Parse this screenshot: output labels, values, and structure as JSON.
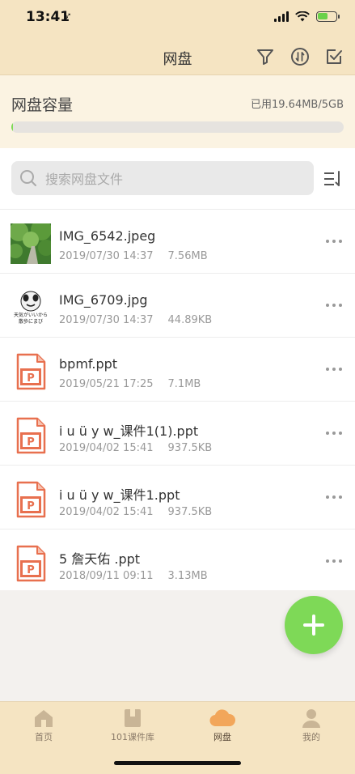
{
  "status_bar": {
    "time": "13:41",
    "location_glyph": "➶"
  },
  "nav": {
    "title": "网盘",
    "icons": [
      "filter-icon",
      "transfer-icon",
      "select-icon"
    ]
  },
  "quota": {
    "label": "网盘容量",
    "used_text": "已用19.64MB/5GB",
    "progress_fraction": 0.004
  },
  "search": {
    "placeholder": "搜索网盘文件",
    "value": ""
  },
  "files": [
    {
      "name": "IMG_6542.jpeg",
      "date": "2019/07/30 14:37",
      "size": "7.56MB",
      "icon": "photo-thumbnail-icon"
    },
    {
      "name": "IMG_6709.jpg",
      "date": "2019/07/30 14:37",
      "size": "44.89KB",
      "icon": "meme-thumbnail-icon",
      "thumb_text": [
        "天気がいいから",
        "散歩にまび"
      ]
    },
    {
      "name": "bpmf.ppt",
      "date": "2019/05/21 17:25",
      "size": "7.1MB",
      "icon": "ppt-file-icon"
    },
    {
      "name": "i u ü y w_课件1(1).ppt",
      "date": "2019/04/02 15:41",
      "size": "937.5KB",
      "icon": "ppt-file-icon"
    },
    {
      "name": "i u ü y w_课件1.ppt",
      "date": "2019/04/02 15:41",
      "size": "937.5KB",
      "icon": "ppt-file-icon"
    },
    {
      "name": "5 詹天佑 .ppt",
      "date": "2018/09/11 09:11",
      "size": "3.13MB",
      "icon": "ppt-file-icon"
    }
  ],
  "ppt_letter": "P",
  "tabs": [
    {
      "label": "首页",
      "icon": "home-icon",
      "active": false
    },
    {
      "label": "101课件库",
      "icon": "library-icon",
      "active": false
    },
    {
      "label": "网盘",
      "icon": "cloud-icon",
      "active": true
    },
    {
      "label": "我的",
      "icon": "profile-icon",
      "active": false
    }
  ],
  "colors": {
    "accent_green": "#7ed957",
    "header_bg": "#f5e4c2",
    "ppt_orange": "#e8704f",
    "cloud_orange": "#f2a65a"
  }
}
